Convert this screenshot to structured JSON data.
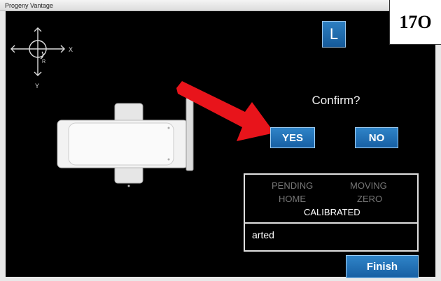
{
  "window": {
    "title": "Progeny Vantage"
  },
  "badge": {
    "label": "17O"
  },
  "side_button": {
    "label": "L"
  },
  "axis": {
    "x_label": "X",
    "y_label": "Y",
    "r_label": "R"
  },
  "dialog": {
    "prompt": "Confirm?",
    "yes_label": "YES",
    "no_label": "NO"
  },
  "status": {
    "pending": "PENDING",
    "moving": "MOVING",
    "home": "HOME",
    "zero": "ZERO",
    "calibrated": "CALIBRATED"
  },
  "log": {
    "text": "arted"
  },
  "footer": {
    "finish_label": "Finish"
  },
  "colors": {
    "accent": "#1a64a8",
    "annotation_arrow": "#e8141b",
    "background": "#000000"
  }
}
